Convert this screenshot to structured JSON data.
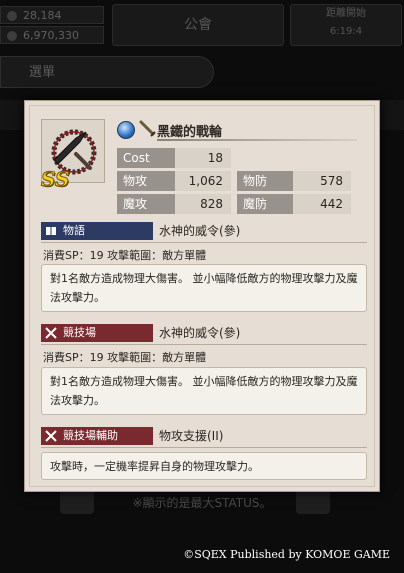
{
  "background": {
    "stat1": "28,184",
    "stat2": "6,970,330",
    "guild_label": "公會",
    "time_label": "距離開始",
    "time_value": "6:19:4",
    "menu_label": "選單",
    "note": "※顯示的是最大STATUS。"
  },
  "weapon": {
    "name": "黑鐵的戰輪",
    "rarity": "SS",
    "element_icon": "water-element-icon",
    "category_icon": "sword-category-icon"
  },
  "stats": {
    "cost_label": "Cost",
    "cost_value": "18",
    "patk_label": "物攻",
    "patk_value": "1,062",
    "pdef_label": "物防",
    "pdef_value": "578",
    "matk_label": "魔攻",
    "matk_value": "828",
    "mdef_label": "魔防",
    "mdef_value": "442"
  },
  "sections": {
    "story": {
      "tag": "物語",
      "name": "水神的威令(參)",
      "info": "消費SP：19 攻擊範圍：敵方單體",
      "desc": "對1名敵方造成物理大傷害。 並小幅降低敵方的物理攻擊力及魔法攻擊力。"
    },
    "arena": {
      "tag": "競技場",
      "name": "水神的威令(參)",
      "info": "消費SP：19 攻擊範圍：敵方單體",
      "desc": "對1名敵方造成物理大傷害。 並小幅降低敵方的物理攻擊力及魔法攻擊力。"
    },
    "support": {
      "tag": "競技場輔助",
      "name": "物攻支援(II)",
      "desc": "攻擊時，一定機率提昇自身的物理攻擊力。"
    }
  },
  "colors": {
    "story_tag": "#2d3a63",
    "arena_tag": "#7a2a2f",
    "support_tag": "#7a2a2f",
    "rarity": "#f3d226"
  },
  "copyright": "©SQEX Published by KOMOE GAME"
}
